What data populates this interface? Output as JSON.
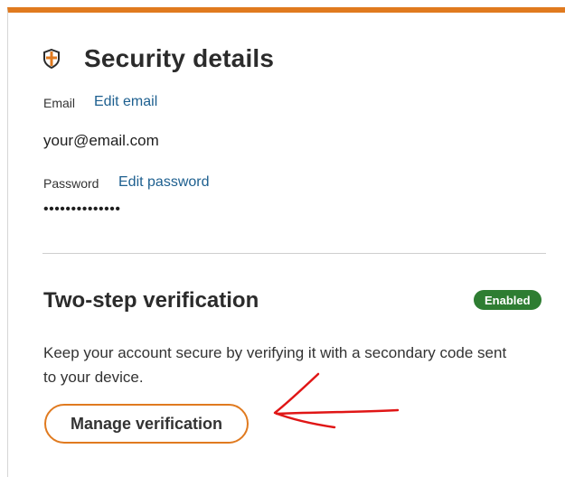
{
  "colors": {
    "accent": "#e07a1f",
    "link": "#1d5f8f",
    "badge": "#2e7d32",
    "annotation": "#e01616"
  },
  "security": {
    "icon": "shield-icon",
    "title": "Security details",
    "email_label": "Email",
    "edit_email": "Edit email",
    "email_value": "your@email.com",
    "password_label": "Password",
    "edit_password": "Edit password",
    "password_value": "••••••••••••••"
  },
  "two_step": {
    "title": "Two-step verification",
    "status_badge": "Enabled",
    "description": "Keep your account secure by verifying it with a secondary code sent to your device.",
    "manage_button": "Manage verification"
  },
  "annotation": {
    "icon": "red-arrow-icon"
  }
}
